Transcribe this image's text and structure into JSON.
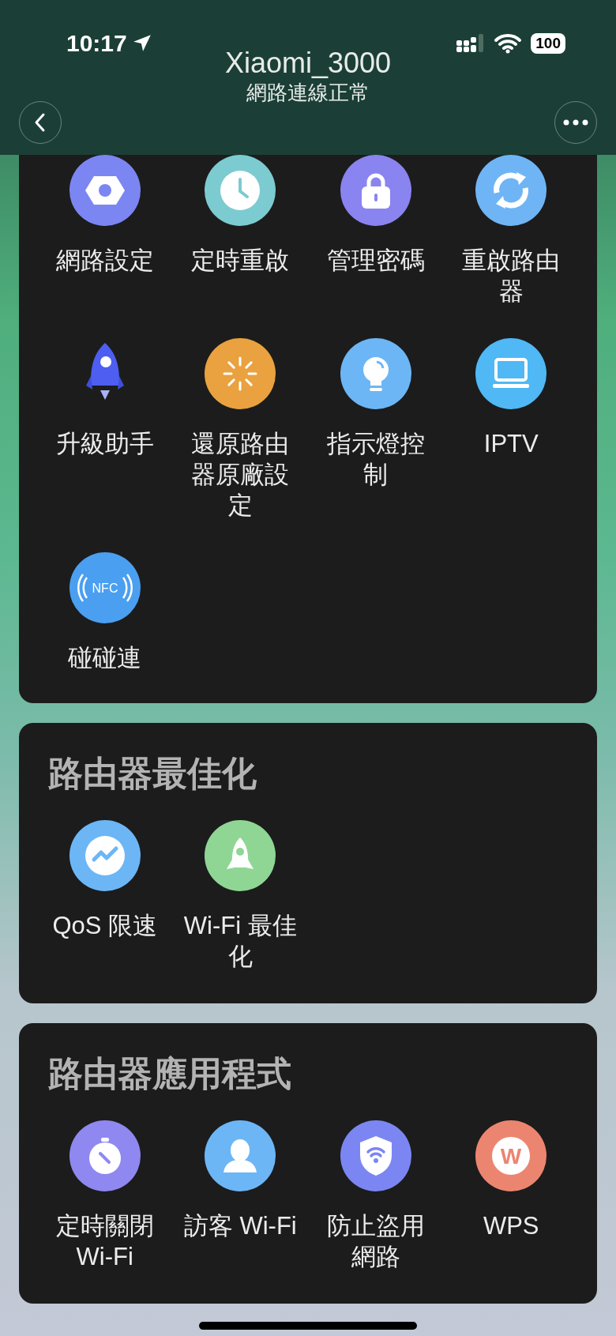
{
  "status_bar": {
    "time": "10:17",
    "battery": "100"
  },
  "header": {
    "title": "Xiaomi_3000",
    "subtitle": "網路連線正常"
  },
  "sections": [
    {
      "items": [
        {
          "lines": [
            "網路設定"
          ]
        },
        {
          "lines": [
            "定時重啟"
          ]
        },
        {
          "lines": [
            "管理密碼"
          ]
        },
        {
          "lines": [
            "重啟路由",
            "器"
          ]
        },
        {
          "lines": [
            "升級助手"
          ]
        },
        {
          "lines": [
            "還原路由",
            "器原廠設",
            "定"
          ]
        },
        {
          "lines": [
            "指示燈控",
            "制"
          ]
        },
        {
          "lines": [
            "IPTV"
          ]
        },
        {
          "lines": [
            "碰碰連"
          ],
          "icon_text": "NFC"
        }
      ]
    },
    {
      "title": "路由器最佳化",
      "items": [
        {
          "lines": [
            "QoS 限速"
          ]
        },
        {
          "lines": [
            "Wi-Fi 最佳",
            "化"
          ]
        }
      ]
    },
    {
      "title": "路由器應用程式",
      "items": [
        {
          "lines": [
            "定時關閉",
            "Wi-Fi"
          ]
        },
        {
          "lines": [
            "訪客 Wi-Fi"
          ]
        },
        {
          "lines": [
            "防止盜用",
            "網路"
          ]
        },
        {
          "lines": [
            "WPS"
          ],
          "icon_text": "W"
        }
      ]
    }
  ]
}
